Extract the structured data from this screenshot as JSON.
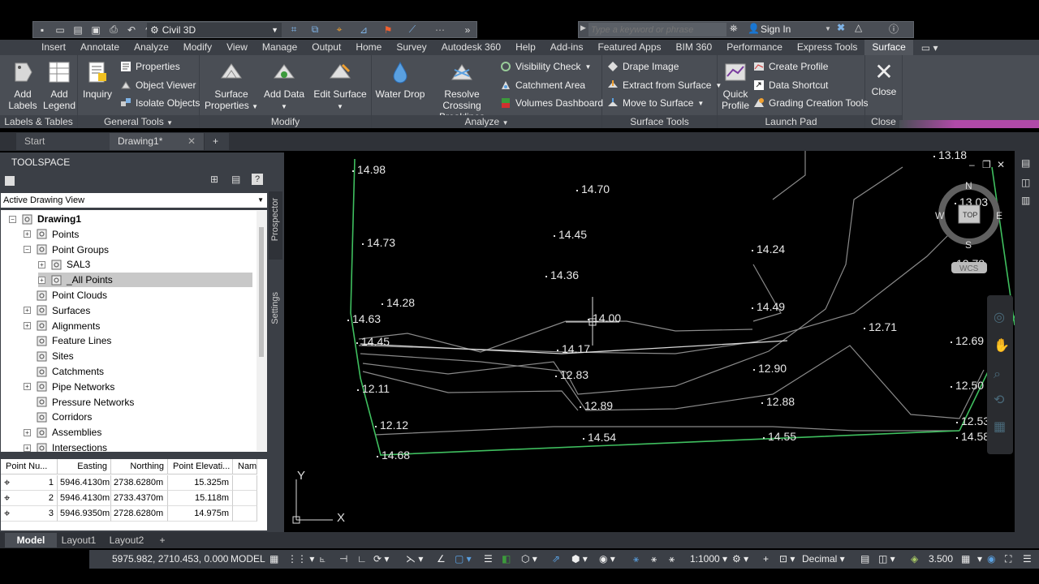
{
  "qat": {
    "workspace": "Civil 3D"
  },
  "search": {
    "placeholder": "Type a keyword or phrase",
    "sign_in": "Sign In"
  },
  "ribbon_tabs": [
    "Insert",
    "Annotate",
    "Analyze",
    "Modify",
    "View",
    "Manage",
    "Output",
    "Home",
    "Survey",
    "Autodesk 360",
    "Help",
    "Add-ins",
    "Featured Apps",
    "BIM 360",
    "Performance",
    "Express Tools",
    "Surface"
  ],
  "ribbon": {
    "labels_tables": {
      "title": "Labels & Tables",
      "add_labels": [
        "Add",
        "Labels"
      ],
      "add_legend": [
        "Add",
        "Legend"
      ]
    },
    "general_tools": {
      "title": "General Tools",
      "inquiry": "Inquiry",
      "properties": "Properties",
      "object_viewer": "Object Viewer",
      "isolate_objects": "Isolate Objects"
    },
    "modify": {
      "title": "Modify",
      "surface_properties": [
        "Surface",
        "Properties"
      ],
      "add_data": "Add Data",
      "edit_surface": "Edit Surface"
    },
    "analyze": {
      "title": "Analyze",
      "water_drop": "Water Drop",
      "resolve_crossing": [
        "Resolve Crossing",
        "Breaklines"
      ],
      "visibility_check": "Visibility Check",
      "catchment_area": "Catchment Area",
      "volumes_dashboard": "Volumes Dashboard"
    },
    "surface_tools": {
      "title": "Surface Tools",
      "drape_image": "Drape Image",
      "extract_from_surface": "Extract from Surface",
      "move_to_surface": "Move to Surface"
    },
    "launch_pad": {
      "title": "Launch Pad",
      "quick_profile": [
        "Quick",
        "Profile"
      ],
      "create_profile": "Create Profile",
      "data_shortcut": "Data Shortcut",
      "grading_creation_tools": "Grading Creation Tools"
    },
    "close": {
      "title": "Close",
      "close": "Close"
    }
  },
  "file_tabs": {
    "start": "Start",
    "drawing": "Drawing1*"
  },
  "toolspace": {
    "title": "TOOLSPACE",
    "view_select": "Active Drawing View",
    "side_tabs": [
      "Prospector",
      "Settings"
    ],
    "tree": [
      {
        "label": "Drawing1",
        "level": 0,
        "icon": "drawing-icon"
      },
      {
        "label": "Points",
        "level": 1,
        "icon": "points-icon"
      },
      {
        "label": "Point Groups",
        "level": 1,
        "icon": "point-groups-icon"
      },
      {
        "label": "SAL3",
        "level": 2,
        "icon": "point-group-icon"
      },
      {
        "label": "_All Points",
        "level": 2,
        "icon": "point-group-icon",
        "selected": true
      },
      {
        "label": "Point Clouds",
        "level": 1,
        "icon": "point-clouds-icon"
      },
      {
        "label": "Surfaces",
        "level": 1,
        "icon": "surfaces-icon"
      },
      {
        "label": "Alignments",
        "level": 1,
        "icon": "alignments-icon"
      },
      {
        "label": "Feature Lines",
        "level": 1,
        "icon": "feature-lines-icon"
      },
      {
        "label": "Sites",
        "level": 1,
        "icon": "sites-icon"
      },
      {
        "label": "Catchments",
        "level": 1,
        "icon": "catchments-icon"
      },
      {
        "label": "Pipe Networks",
        "level": 1,
        "icon": "pipe-networks-icon"
      },
      {
        "label": "Pressure Networks",
        "level": 1,
        "icon": "pressure-networks-icon"
      },
      {
        "label": "Corridors",
        "level": 1,
        "icon": "corridors-icon"
      },
      {
        "label": "Assemblies",
        "level": 1,
        "icon": "assemblies-icon"
      },
      {
        "label": "Intersections",
        "level": 1,
        "icon": "intersections-icon"
      }
    ],
    "table": {
      "columns": [
        "Point Nu...",
        "Easting",
        "Northing",
        "Point Elevati...",
        "Nam"
      ],
      "rows": [
        [
          "1",
          "5946.4130m",
          "2738.6280m",
          "15.325m",
          ""
        ],
        [
          "2",
          "5946.4130m",
          "2733.4370m",
          "15.118m",
          ""
        ],
        [
          "3",
          "5946.9350m",
          "2728.6280m",
          "14.975m",
          ""
        ]
      ]
    }
  },
  "viewport": {
    "elevations": [
      "14.98",
      "14.70",
      "14.73",
      "14.45",
      "14.24",
      "14.36",
      "14.28",
      "14.00",
      "14.49",
      "14.63",
      "12.71",
      "14.45",
      "14.17",
      "12.69",
      "12.83",
      "12.90",
      "12.11",
      "12.50",
      "12.89",
      "12.88",
      "12.12",
      "12.53",
      "14.54",
      "14.55",
      "14.58",
      "14.68",
      "13.18",
      "13.03",
      "12.78"
    ],
    "viewcube": {
      "n": "N",
      "s": "S",
      "e": "E",
      "w": "W",
      "top": "TOP",
      "wcs": "WCS"
    },
    "ucs": {
      "x": "X",
      "y": "Y"
    }
  },
  "layout_tabs": [
    "Model",
    "Layout1",
    "Layout2"
  ],
  "status": {
    "coords": "5975.982, 2710.453, 0.000",
    "space": "MODEL",
    "scale": "1:1000",
    "units": "Decimal",
    "elevation": "3.500"
  },
  "colors": {
    "accent_tab": "#52565d",
    "green_line": "#3fbf5f",
    "magenta": "#b04aa8"
  }
}
